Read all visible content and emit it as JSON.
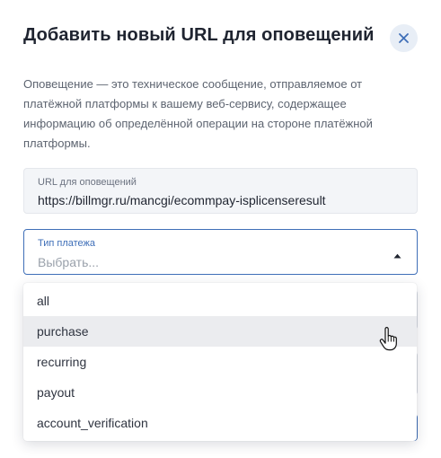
{
  "modal": {
    "title": "Добавить новый URL для оповещений",
    "description": "Оповещение — это техническое сообщение, отправляемое от платёжной платформы к вашему веб-сервису, содержащее информацию об определённой операции на стороне платёжной платформы."
  },
  "url_field": {
    "label": "URL для оповещений",
    "value": "https://billmgr.ru/mancgi/ecommpay-isplicenseresult"
  },
  "payment_type_field": {
    "label": "Тип платежа",
    "placeholder": "Выбрать..."
  },
  "dropdown": {
    "options": [
      {
        "label": "all"
      },
      {
        "label": "purchase"
      },
      {
        "label": "recurring"
      },
      {
        "label": "payout"
      },
      {
        "label": "account_verification"
      }
    ],
    "hovered_option": "purchase"
  },
  "icons": {
    "close": "close-icon",
    "caret": "caret-up-icon",
    "cursor": "hand-pointer-icon"
  },
  "colors": {
    "accent": "#3f6fb8",
    "close_bg": "#e8eef6",
    "hover_bg": "#ebecef"
  }
}
